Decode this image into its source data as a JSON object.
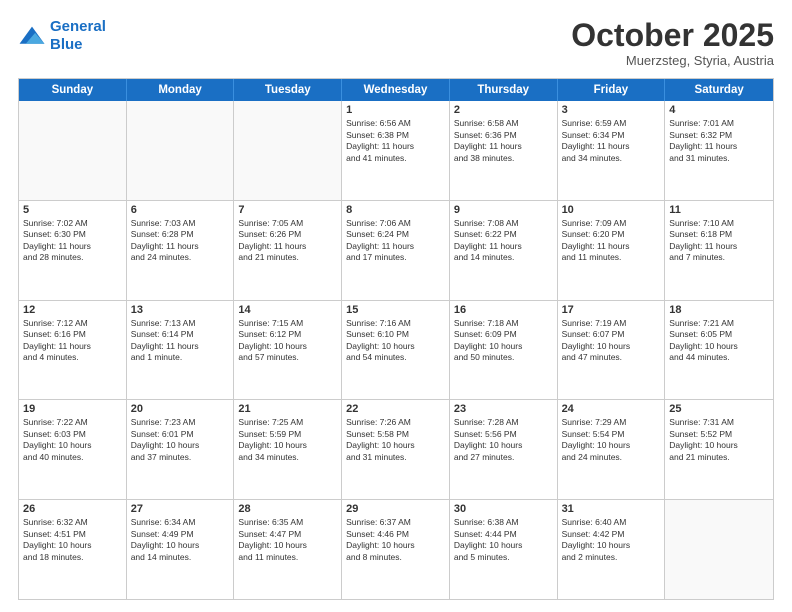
{
  "logo": {
    "line1": "General",
    "line2": "Blue"
  },
  "header": {
    "title": "October 2025",
    "subtitle": "Muerzsteg, Styria, Austria"
  },
  "weekdays": [
    "Sunday",
    "Monday",
    "Tuesday",
    "Wednesday",
    "Thursday",
    "Friday",
    "Saturday"
  ],
  "rows": [
    [
      {
        "day": "",
        "text": "",
        "empty": true
      },
      {
        "day": "",
        "text": "",
        "empty": true
      },
      {
        "day": "",
        "text": "",
        "empty": true
      },
      {
        "day": "1",
        "text": "Sunrise: 6:56 AM\nSunset: 6:38 PM\nDaylight: 11 hours\nand 41 minutes."
      },
      {
        "day": "2",
        "text": "Sunrise: 6:58 AM\nSunset: 6:36 PM\nDaylight: 11 hours\nand 38 minutes."
      },
      {
        "day": "3",
        "text": "Sunrise: 6:59 AM\nSunset: 6:34 PM\nDaylight: 11 hours\nand 34 minutes."
      },
      {
        "day": "4",
        "text": "Sunrise: 7:01 AM\nSunset: 6:32 PM\nDaylight: 11 hours\nand 31 minutes."
      }
    ],
    [
      {
        "day": "5",
        "text": "Sunrise: 7:02 AM\nSunset: 6:30 PM\nDaylight: 11 hours\nand 28 minutes."
      },
      {
        "day": "6",
        "text": "Sunrise: 7:03 AM\nSunset: 6:28 PM\nDaylight: 11 hours\nand 24 minutes."
      },
      {
        "day": "7",
        "text": "Sunrise: 7:05 AM\nSunset: 6:26 PM\nDaylight: 11 hours\nand 21 minutes."
      },
      {
        "day": "8",
        "text": "Sunrise: 7:06 AM\nSunset: 6:24 PM\nDaylight: 11 hours\nand 17 minutes."
      },
      {
        "day": "9",
        "text": "Sunrise: 7:08 AM\nSunset: 6:22 PM\nDaylight: 11 hours\nand 14 minutes."
      },
      {
        "day": "10",
        "text": "Sunrise: 7:09 AM\nSunset: 6:20 PM\nDaylight: 11 hours\nand 11 minutes."
      },
      {
        "day": "11",
        "text": "Sunrise: 7:10 AM\nSunset: 6:18 PM\nDaylight: 11 hours\nand 7 minutes."
      }
    ],
    [
      {
        "day": "12",
        "text": "Sunrise: 7:12 AM\nSunset: 6:16 PM\nDaylight: 11 hours\nand 4 minutes."
      },
      {
        "day": "13",
        "text": "Sunrise: 7:13 AM\nSunset: 6:14 PM\nDaylight: 11 hours\nand 1 minute."
      },
      {
        "day": "14",
        "text": "Sunrise: 7:15 AM\nSunset: 6:12 PM\nDaylight: 10 hours\nand 57 minutes."
      },
      {
        "day": "15",
        "text": "Sunrise: 7:16 AM\nSunset: 6:10 PM\nDaylight: 10 hours\nand 54 minutes."
      },
      {
        "day": "16",
        "text": "Sunrise: 7:18 AM\nSunset: 6:09 PM\nDaylight: 10 hours\nand 50 minutes."
      },
      {
        "day": "17",
        "text": "Sunrise: 7:19 AM\nSunset: 6:07 PM\nDaylight: 10 hours\nand 47 minutes."
      },
      {
        "day": "18",
        "text": "Sunrise: 7:21 AM\nSunset: 6:05 PM\nDaylight: 10 hours\nand 44 minutes."
      }
    ],
    [
      {
        "day": "19",
        "text": "Sunrise: 7:22 AM\nSunset: 6:03 PM\nDaylight: 10 hours\nand 40 minutes."
      },
      {
        "day": "20",
        "text": "Sunrise: 7:23 AM\nSunset: 6:01 PM\nDaylight: 10 hours\nand 37 minutes."
      },
      {
        "day": "21",
        "text": "Sunrise: 7:25 AM\nSunset: 5:59 PM\nDaylight: 10 hours\nand 34 minutes."
      },
      {
        "day": "22",
        "text": "Sunrise: 7:26 AM\nSunset: 5:58 PM\nDaylight: 10 hours\nand 31 minutes."
      },
      {
        "day": "23",
        "text": "Sunrise: 7:28 AM\nSunset: 5:56 PM\nDaylight: 10 hours\nand 27 minutes."
      },
      {
        "day": "24",
        "text": "Sunrise: 7:29 AM\nSunset: 5:54 PM\nDaylight: 10 hours\nand 24 minutes."
      },
      {
        "day": "25",
        "text": "Sunrise: 7:31 AM\nSunset: 5:52 PM\nDaylight: 10 hours\nand 21 minutes."
      }
    ],
    [
      {
        "day": "26",
        "text": "Sunrise: 6:32 AM\nSunset: 4:51 PM\nDaylight: 10 hours\nand 18 minutes."
      },
      {
        "day": "27",
        "text": "Sunrise: 6:34 AM\nSunset: 4:49 PM\nDaylight: 10 hours\nand 14 minutes."
      },
      {
        "day": "28",
        "text": "Sunrise: 6:35 AM\nSunset: 4:47 PM\nDaylight: 10 hours\nand 11 minutes."
      },
      {
        "day": "29",
        "text": "Sunrise: 6:37 AM\nSunset: 4:46 PM\nDaylight: 10 hours\nand 8 minutes."
      },
      {
        "day": "30",
        "text": "Sunrise: 6:38 AM\nSunset: 4:44 PM\nDaylight: 10 hours\nand 5 minutes."
      },
      {
        "day": "31",
        "text": "Sunrise: 6:40 AM\nSunset: 4:42 PM\nDaylight: 10 hours\nand 2 minutes."
      },
      {
        "day": "",
        "text": "",
        "empty": true
      }
    ]
  ]
}
